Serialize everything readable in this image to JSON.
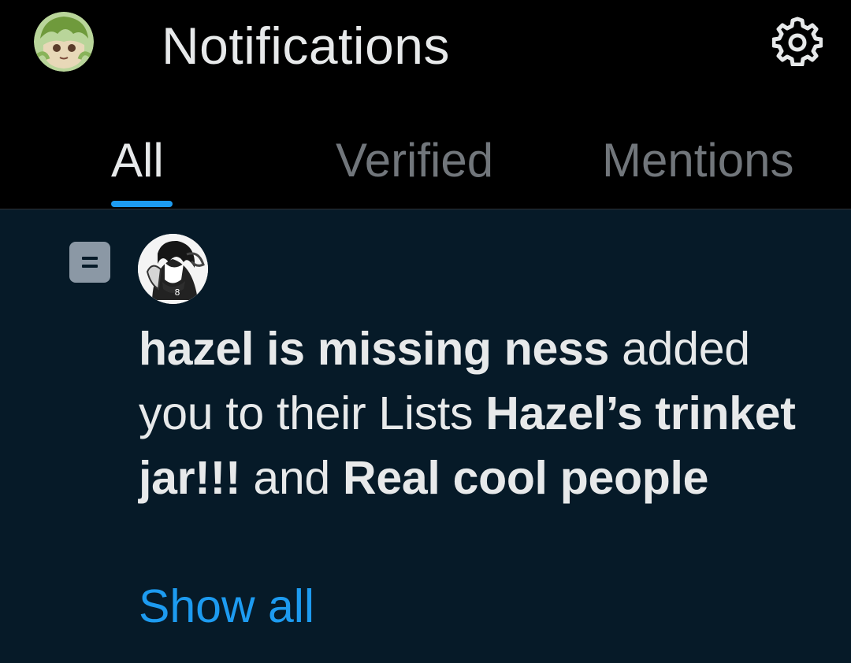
{
  "header": {
    "title": "Notifications",
    "avatar_icon": "user-avatar-icon",
    "settings_icon": "gear-icon"
  },
  "tabs": [
    {
      "label": "All",
      "active": true
    },
    {
      "label": "Verified",
      "active": false
    },
    {
      "label": "Mentions",
      "active": false
    }
  ],
  "notification": {
    "icon": "list-icon",
    "actor_avatar_icon": "actor-avatar-icon",
    "actor_name": "hazel is missing ness",
    "text_added": " added you to their Lists ",
    "list_one": "Hazel’s trinket jar!!!",
    "text_and": " and ",
    "list_two": "Real cool people",
    "show_all": "Show all"
  },
  "colors": {
    "header_background": "#000000",
    "feed_background": "#061a28",
    "accent": "#1d9bf0",
    "primary_text": "#e7e9ea",
    "secondary_text": "#71767b"
  }
}
